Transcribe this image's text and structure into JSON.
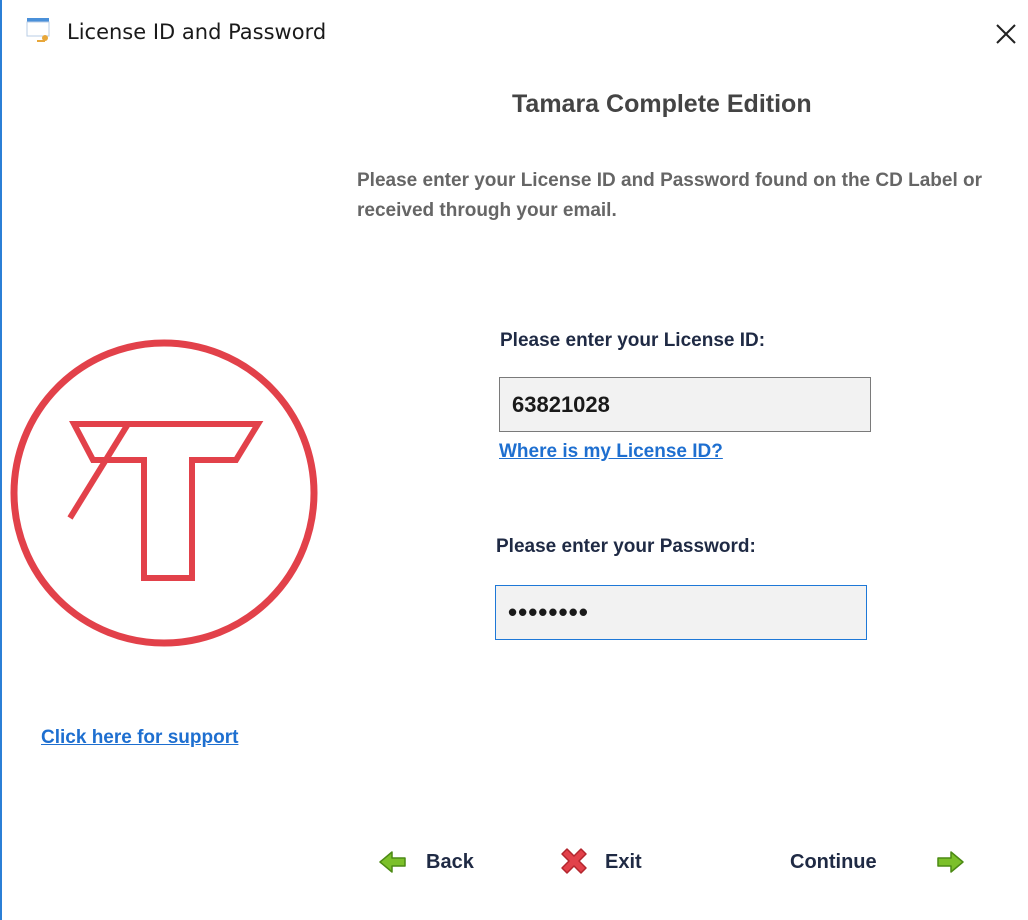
{
  "window": {
    "title": "License ID and Password",
    "accent": "#2b7fd6"
  },
  "header": {
    "product_title": "Tamara Complete Edition",
    "instructions": "Please enter your License ID and Password found on the CD Label or received through your email."
  },
  "license": {
    "label": "Please enter your License ID:",
    "value": "63821028",
    "help_link": "Where is my License ID?"
  },
  "password": {
    "label": "Please enter your Password:",
    "masked_value": "••••••••"
  },
  "support": {
    "link": "Click here for support"
  },
  "buttons": {
    "back": "Back",
    "exit": "Exit",
    "continue": "Continue"
  },
  "icons": {
    "app": "window-key-icon",
    "close": "close-icon",
    "logo": "tamara-logo",
    "back": "arrow-left-icon",
    "exit": "red-x-icon",
    "continue": "arrow-right-icon"
  },
  "colors": {
    "logo_red": "#e2414a",
    "link_blue": "#1e6fd0",
    "arrow_green": "#7cc02a",
    "exit_red": "#e2414a"
  }
}
